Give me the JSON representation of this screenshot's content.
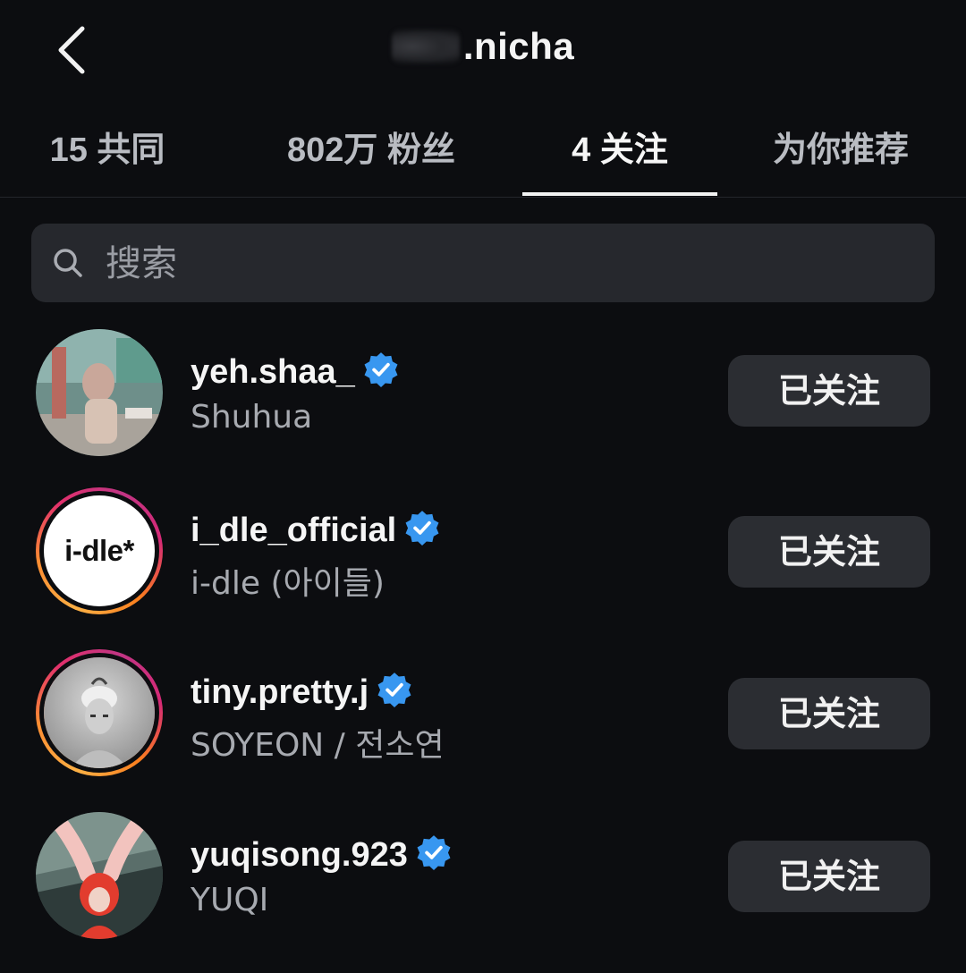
{
  "header": {
    "back_icon": "chevron-left-icon",
    "title": ".nicha"
  },
  "tabs": [
    {
      "label": "15 共同",
      "active": false
    },
    {
      "label": "802万 粉丝",
      "active": false
    },
    {
      "label": "4 关注",
      "active": true
    },
    {
      "label": "为你推荐",
      "active": false
    }
  ],
  "search": {
    "placeholder": "搜索",
    "value": "",
    "icon": "search-icon"
  },
  "following": [
    {
      "username": "yeh.shaa_",
      "full_name": "Shuhua",
      "verified": true,
      "story_ring": false,
      "button_label": "已关注"
    },
    {
      "username": "i_dle_official",
      "full_name": "i-dle (아이들)",
      "verified": true,
      "story_ring": true,
      "avatar_text": "i-dle*",
      "button_label": "已关注"
    },
    {
      "username": "tiny.pretty.j",
      "full_name": "SOYEON / 전소연",
      "verified": true,
      "story_ring": true,
      "button_label": "已关注"
    },
    {
      "username": "yuqisong.923",
      "full_name": "YUQI",
      "verified": true,
      "story_ring": false,
      "button_label": "已关注"
    }
  ],
  "colors": {
    "background": "#0c0d10",
    "verified_blue": "#3897f0",
    "button_bg": "#2b2d32",
    "search_bg": "#26282d"
  }
}
